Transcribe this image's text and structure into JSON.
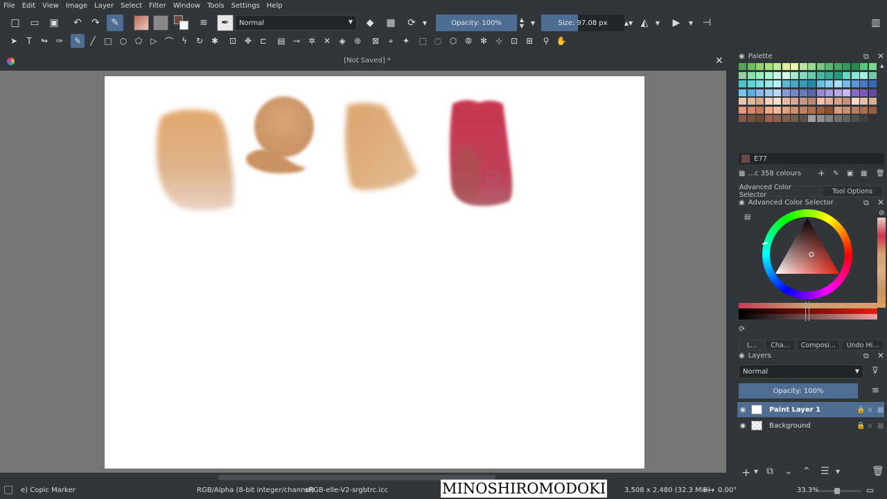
{
  "menu": [
    "File",
    "Edit",
    "View",
    "Image",
    "Layer",
    "Select",
    "Filter",
    "Window",
    "Tools",
    "Settings",
    "Help"
  ],
  "toolbar": {
    "blend_mode": "Normal",
    "opacity": "Opacity: 100%",
    "opacity_value": 1.0,
    "size": "Size: 97.08 px",
    "size_fraction": 0.44
  },
  "document": {
    "title": "[Not Saved]",
    "modified_mark": "*"
  },
  "palette": {
    "title": "Palette",
    "selected_swatch": "E77",
    "colours_count": "...c 358 colours"
  },
  "color_selector": {
    "tabs": [
      "Advanced Color Selector",
      "Tool Options"
    ],
    "title": "Advanced Color Selector"
  },
  "bottom_tabs": [
    "L...",
    "Cha...",
    "Composi...",
    "Undo Hi..."
  ],
  "layers": {
    "title": "Layers",
    "blend_mode": "Normal",
    "opacity": "Opacity:  100%",
    "opacity_value": 1.0,
    "items": [
      {
        "name": "Paint Layer 1",
        "selected": true
      },
      {
        "name": "Background",
        "selected": false,
        "locked": true
      }
    ]
  },
  "status": {
    "brush": "e) Copic Marker",
    "color_model": "RGB/Alpha (8-bit integer/channel)",
    "profile": "sRGB-elle-V2-srgbtrc.icc",
    "watermark": "MINOSHIROMODOKI",
    "dimensions": "3,508 x 2,480 (32.3 MiB)",
    "rotation": "0.00°",
    "zoom": "33.3%"
  },
  "colors": {
    "accent": "#4d6d92",
    "bg": "#31363b",
    "canvas_bg": "#767676"
  }
}
